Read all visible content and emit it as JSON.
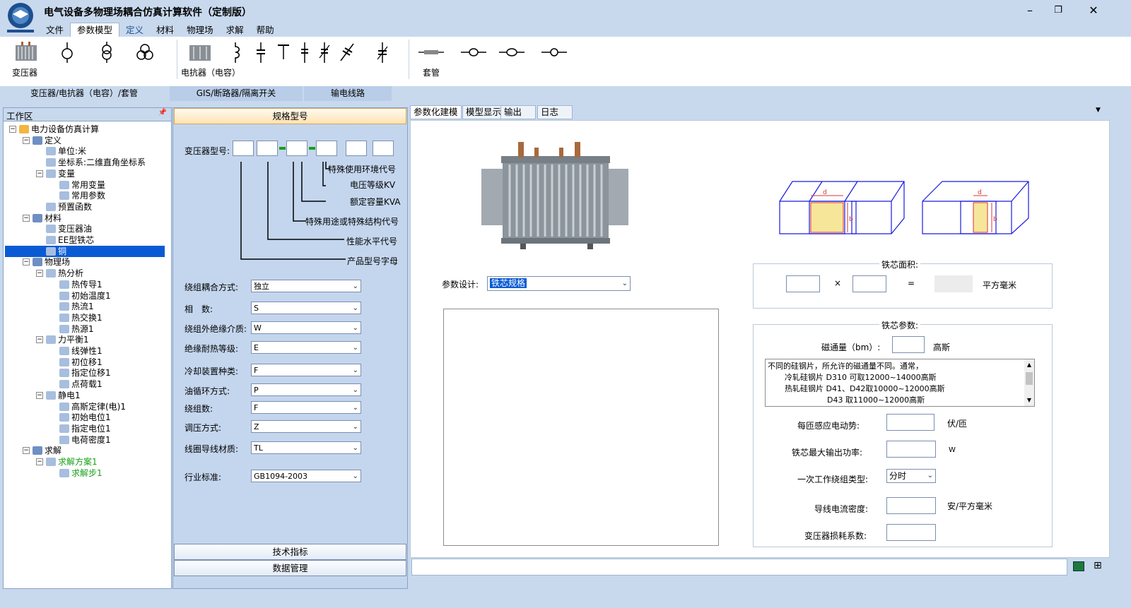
{
  "app": {
    "title": "电气设备多物理场耦合仿真计算软件（定制版）"
  },
  "menu": [
    "文件",
    "参数模型",
    "定义",
    "材料",
    "物理场",
    "求解",
    "帮助"
  ],
  "ribbon": {
    "transformer_label": "变压器",
    "reactor_label": "电抗器（电容）",
    "bushing_label": "套管",
    "groups": [
      "变压器/电抗器（电容）/套管",
      "GIS/断路器/隔离开关",
      "输电线路"
    ]
  },
  "workspace": {
    "title": "工作区",
    "tree": [
      {
        "label": "电力设备仿真计算",
        "level": 0,
        "icon": "folder-icon"
      },
      {
        "label": "定义",
        "level": 1,
        "icon": "gear-icon"
      },
      {
        "label": "单位:米",
        "level": 2,
        "icon": "unit-icon"
      },
      {
        "label": "坐标系:二维直角坐标系",
        "level": 2,
        "icon": "axis-icon"
      },
      {
        "label": "变量",
        "level": 2,
        "icon": "variable-icon"
      },
      {
        "label": "常用变量",
        "level": 3,
        "icon": "variable-icon"
      },
      {
        "label": "常用参数",
        "level": 3,
        "icon": "param-icon"
      },
      {
        "label": "预置函数",
        "level": 2,
        "icon": "function-icon"
      },
      {
        "label": "材料",
        "level": 1,
        "icon": "material-icon"
      },
      {
        "label": "变压器油",
        "level": 2,
        "icon": "oil-icon"
      },
      {
        "label": "EE型铁芯",
        "level": 2,
        "icon": "material-icon"
      },
      {
        "label": "铜",
        "level": 2,
        "icon": "material-icon"
      },
      {
        "label": "物理场",
        "level": 1,
        "icon": "physics-icon"
      },
      {
        "label": "热分析",
        "level": 2,
        "icon": "heat-icon"
      },
      {
        "label": "热传导1",
        "level": 3,
        "icon": "heat-conduction-icon"
      },
      {
        "label": "初始温度1",
        "level": 3,
        "icon": "temperature-icon"
      },
      {
        "label": "热流1",
        "level": 3,
        "icon": "heat-flux-icon"
      },
      {
        "label": "热交换1",
        "level": 3,
        "icon": "heat-exchange-icon"
      },
      {
        "label": "热源1",
        "level": 3,
        "icon": "heat-source-icon"
      },
      {
        "label": "力平衡1",
        "level": 2,
        "icon": "force-icon"
      },
      {
        "label": "线弹性1",
        "level": 3,
        "icon": "spring-icon"
      },
      {
        "label": "初位移1",
        "level": 3,
        "icon": "displacement-icon"
      },
      {
        "label": "指定位移1",
        "level": 3,
        "icon": "displacement-icon"
      },
      {
        "label": "点荷载1",
        "level": 3,
        "icon": "load-icon"
      },
      {
        "label": "静电1",
        "level": 2,
        "icon": "electrostatic-icon"
      },
      {
        "label": "高斯定律(电)1",
        "level": 3,
        "icon": "gauss-icon"
      },
      {
        "label": "初始电位1",
        "level": 3,
        "icon": "potential-icon"
      },
      {
        "label": "指定电位1",
        "level": 3,
        "icon": "potential-icon"
      },
      {
        "label": "电荷密度1",
        "level": 3,
        "icon": "charge-icon"
      },
      {
        "label": "求解",
        "level": 1,
        "icon": "solve-icon"
      },
      {
        "label": "求解方案1",
        "level": 2,
        "icon": "solution-icon"
      },
      {
        "label": "求解步1",
        "level": 3,
        "icon": "step-icon"
      }
    ],
    "selected": "铜"
  },
  "spec": {
    "header": "规格型号",
    "model_label": "变压器型号:",
    "annotations": [
      "特殊使用环境代号",
      "电压等级KV",
      "额定容量KVA",
      "特殊用途或特殊结构代号",
      "性能水平代号",
      "产品型号字母"
    ],
    "fields": [
      {
        "label": "绕组耦合方式:",
        "value": "独立"
      },
      {
        "label": "相　数:",
        "value": "S"
      },
      {
        "label": "绕组外绝缘介质:",
        "value": "W"
      },
      {
        "label": "绝缘耐热等级:",
        "value": "E"
      },
      {
        "label": "冷却装置种类:",
        "value": "F"
      },
      {
        "label": "油循环方式:",
        "value": "P"
      },
      {
        "label": "绕组数:",
        "value": "F"
      },
      {
        "label": "调压方式:",
        "value": "Z"
      },
      {
        "label": "线圈导线材质:",
        "value": "TL"
      },
      {
        "label": "行业标准:",
        "value": "GB1094-2003"
      }
    ],
    "tech_button": "技术指标",
    "data_button": "数据管理"
  },
  "tabs": [
    "参数化建模",
    "模型显示",
    "输出",
    "日志"
  ],
  "param": {
    "design_label": "参数设计:",
    "design_value": "铁芯规格",
    "area_title": "铁芯面积:",
    "times": "×",
    "equals": "=",
    "area_unit": "平方毫米",
    "core_title": "铁芯参数:",
    "flux_label": "磁通量（bm）:",
    "flux_unit": "高斯",
    "note_lines": [
      "不同的硅钢片，所允许的磁通量不同。通常，",
      "冷轧硅钢片 D310 可取12000~14000高斯",
      "热轧硅钢片 D41、D42取10000~12000高斯",
      "D43 取11000~12000高斯"
    ],
    "emf_label": "每匝感应电动势:",
    "emf_unit": "伏/匝",
    "power_label": "铁芯最大输出功率:",
    "power_unit": "W",
    "winding_label": "一次工作绕组类型:",
    "winding_value": "分时",
    "density_label": "导线电流密度:",
    "density_unit": "安/平方毫米",
    "loss_label": "变压器损耗系数:"
  },
  "colors": {
    "bg": "#c8d9ee",
    "panel": "#c4d6ee",
    "selected": "#0a5bd3",
    "green": "#1aa01a"
  }
}
